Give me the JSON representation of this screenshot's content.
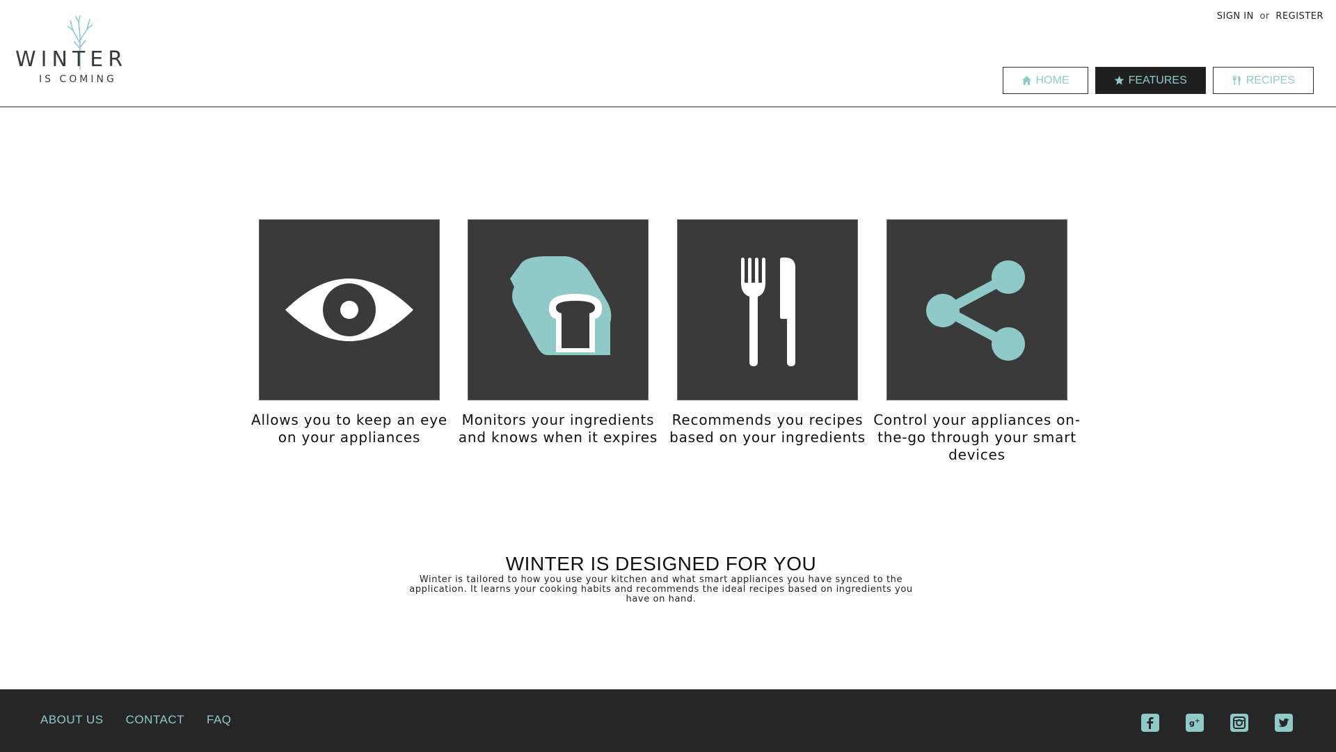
{
  "header": {
    "logo": {
      "word": "WINTER",
      "tagline": "IS COMING"
    },
    "auth": {
      "sign_in": "SIGN IN",
      "or": "or",
      "register": "REGISTER"
    },
    "nav": [
      {
        "label": "HOME",
        "icon": "home-icon",
        "active": false
      },
      {
        "label": "FEATURES",
        "icon": "star-icon",
        "active": true
      },
      {
        "label": "RECIPES",
        "icon": "cutlery-icon",
        "active": false
      }
    ]
  },
  "features": [
    {
      "icon": "eye-icon",
      "caption": "Allows you to keep an eye on your appliances"
    },
    {
      "icon": "bread-tag-icon",
      "caption": "Monitors your ingredients and knows when it expires"
    },
    {
      "icon": "fork-knife-icon",
      "caption": "Recommends you recipes based on your ingredients"
    },
    {
      "icon": "share-icon",
      "caption": "Control your appliances on-the-go through your smart devices"
    }
  ],
  "designed": {
    "title": "WINTER IS DESIGNED FOR YOU",
    "body": "Winter is tailored to how you use your kitchen and what smart appliances you have synced to the application. It learns your cooking habits and recommends the ideal recipes based on ingredients you have on hand."
  },
  "footer": {
    "links": [
      "ABOUT US",
      "CONTACT",
      "FAQ"
    ],
    "social": [
      "facebook-icon",
      "google-plus-icon",
      "instagram-icon",
      "twitter-icon"
    ]
  },
  "colors": {
    "accent": "#8fcac8",
    "tile": "#3b3a3a",
    "footer": "#262626",
    "active_nav": "#1f1f1f"
  }
}
